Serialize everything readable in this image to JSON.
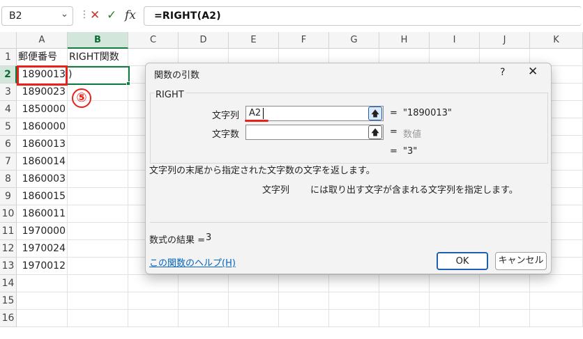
{
  "formula_bar": {
    "name_box": "B2",
    "separator": "⋮",
    "cancel_icon": "✕",
    "enter_icon": "✓",
    "fx_label": "fx",
    "formula": "=RIGHT(A2)"
  },
  "sheet": {
    "columns": [
      "A",
      "B",
      "C",
      "D",
      "E",
      "F",
      "G",
      "H",
      "I",
      "J",
      "K"
    ],
    "rows": [
      "1",
      "2",
      "3",
      "4",
      "5",
      "6",
      "7",
      "8",
      "9",
      "10",
      "11",
      "12",
      "13",
      "14",
      "15",
      "16"
    ],
    "a1": "郵便番号",
    "b1": "RIGHT関数",
    "b2": ")",
    "postal_codes": [
      "1890013",
      "1890023",
      "1850000",
      "1860000",
      "1860013",
      "1860014",
      "1860003",
      "1860015",
      "1860011",
      "1970000",
      "1970024",
      "1970012"
    ]
  },
  "annotation": {
    "step_marker": "⑤",
    "highlight_color": "#e8211a"
  },
  "dialog": {
    "title": "関数の引数",
    "help_icon": "?",
    "close_icon": "✕",
    "function_name": "RIGHT",
    "args": [
      {
        "label": "文字列",
        "value": "A2",
        "equals": "=",
        "result": "\"1890013\""
      },
      {
        "label": "文字数",
        "value": "",
        "equals": "=",
        "result": "数値"
      }
    ],
    "overall_equals": "=",
    "overall_result": "\"3\"",
    "description": "文字列の末尾から指定された文字数の文字を返します。",
    "arg_desc_name": "文字列",
    "arg_desc": "には取り出す文字が含まれる文字列を指定します。",
    "result_label": "数式の結果 =",
    "result_value": "3",
    "help_link": "この関数のヘルプ(H)",
    "ok_button": "OK",
    "cancel_button": "キャンセル"
  }
}
